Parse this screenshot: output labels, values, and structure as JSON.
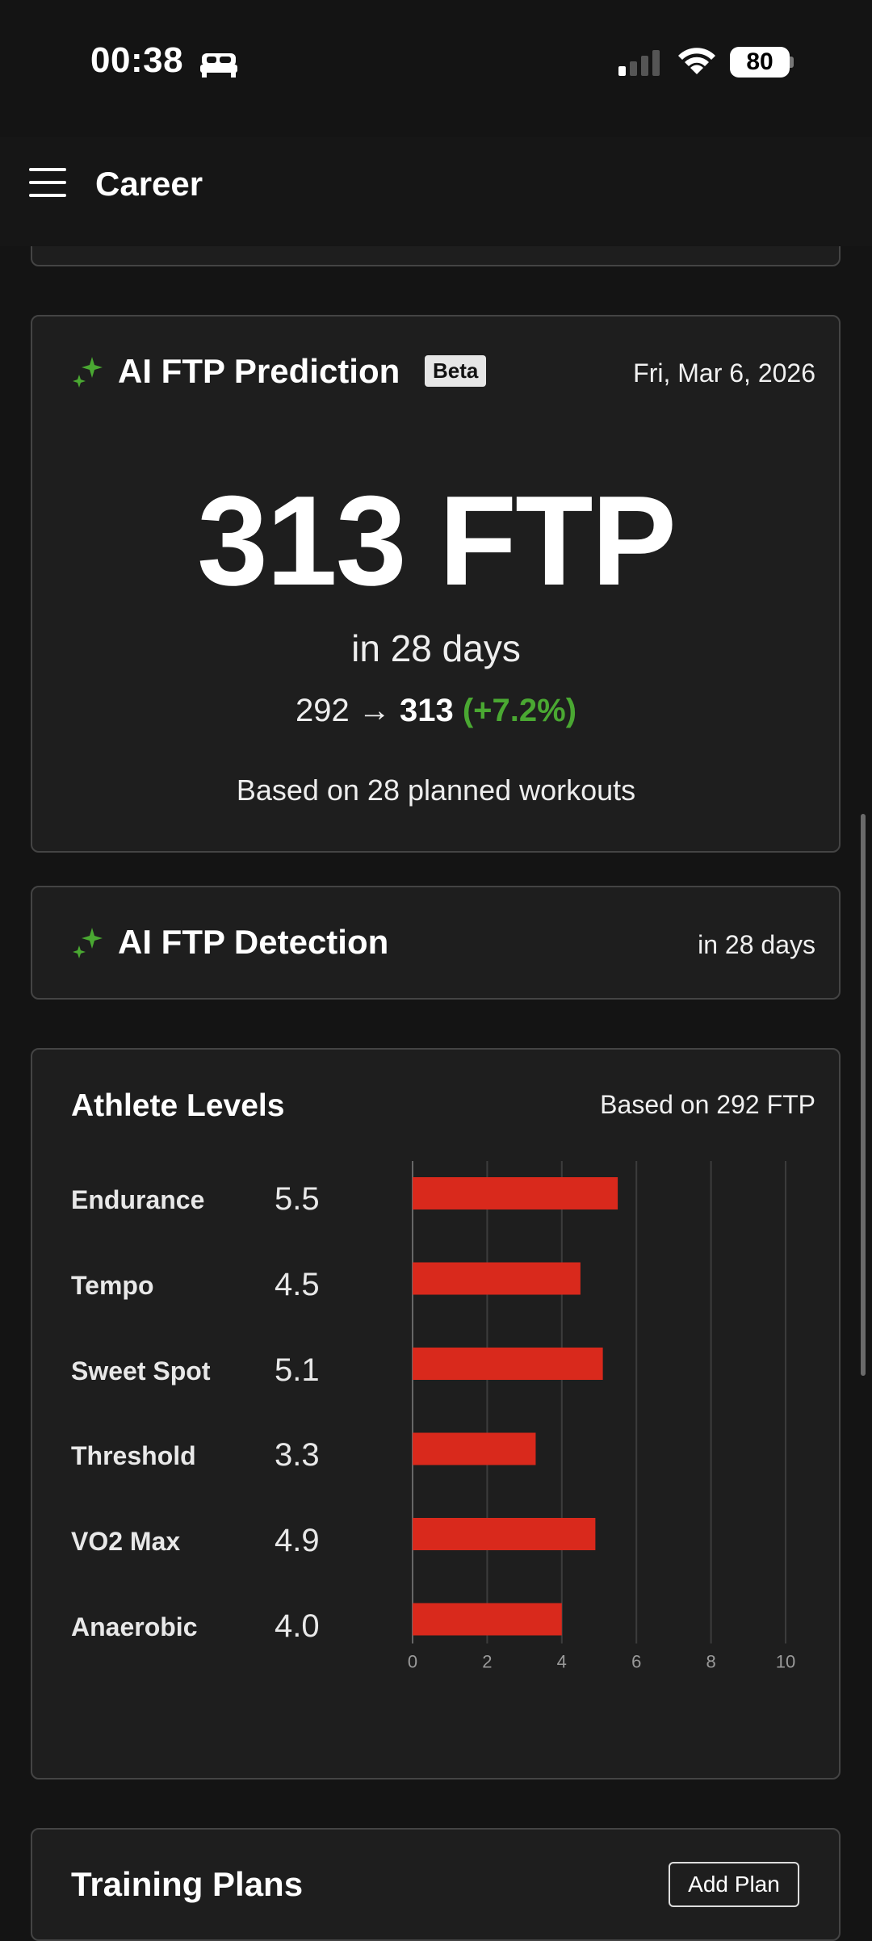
{
  "status_bar": {
    "time": "00:38",
    "battery": "80"
  },
  "header": {
    "title": "Career"
  },
  "prediction": {
    "title": "AI FTP Prediction",
    "badge": "Beta",
    "date": "Fri, Mar 6, 2026",
    "ftp_value": "313 FTP",
    "timeframe": "in 28 days",
    "from": "292",
    "arrow": "→",
    "to": "313",
    "change_pct": "(+7.2%)",
    "basis": "Based on 28 planned workouts"
  },
  "detection": {
    "title": "AI FTP Detection",
    "timeframe": "in 28 days"
  },
  "athlete_levels": {
    "title": "Athlete Levels",
    "basis": "Based on 292 FTP",
    "rows": [
      {
        "label": "Endurance",
        "value": "5.5"
      },
      {
        "label": "Tempo",
        "value": "4.5"
      },
      {
        "label": "Sweet Spot",
        "value": "5.1"
      },
      {
        "label": "Threshold",
        "value": "3.3"
      },
      {
        "label": "VO2 Max",
        "value": "4.9"
      },
      {
        "label": "Anaerobic",
        "value": "4.0"
      }
    ]
  },
  "chart_data": {
    "type": "bar",
    "orientation": "horizontal",
    "categories": [
      "Endurance",
      "Tempo",
      "Sweet Spot",
      "Threshold",
      "VO2 Max",
      "Anaerobic"
    ],
    "values": [
      5.5,
      4.5,
      5.1,
      3.3,
      4.9,
      4.0
    ],
    "xlim": [
      0,
      10
    ],
    "ticks": [
      "0",
      "2",
      "4",
      "6",
      "8",
      "10"
    ],
    "grid": true,
    "bar_color": "#d9291c"
  },
  "training_plans": {
    "title": "Training Plans",
    "add_label": "Add Plan"
  },
  "colors": {
    "accent_green": "#4aa832",
    "bar_red": "#d9291c",
    "background": "#141414",
    "card": "#1e1e1e"
  }
}
